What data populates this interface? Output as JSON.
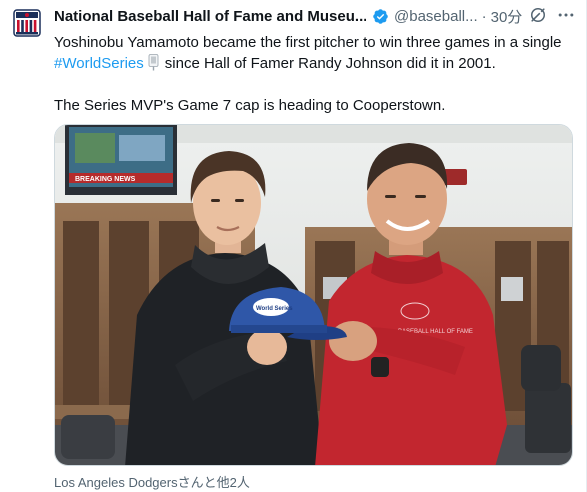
{
  "account": {
    "display_name": "National Baseball Hall of Fame and Museu...",
    "handle": "@baseball...",
    "separator": "·",
    "time": "30分",
    "avatar_icon": "hall-of-fame-logo-icon",
    "verified_icon": "verified-badge-icon",
    "verified_color": "#1d9bf0"
  },
  "post": {
    "line1": "Yoshinobu Yamamoto became the first pitcher to win three games in a single",
    "hashtag": "#WorldSeries",
    "line2_rest": "since Hall of Famer Randy Johnson did it in 2001.",
    "line3": "The Series MVP's Game 7 cap is heading to Cooperstown.",
    "hashtag_emoji_icon": "world-series-trophy-flag-icon",
    "link_color": "#1d9bf0"
  },
  "media": {
    "photo": "two-men-holding-baseball-cap-in-clubhouse",
    "tv_text": "BREAKING NEWS",
    "cap_text": "World Series",
    "shirt_text": "BASEBALL HALL OF FAME"
  },
  "footer": {
    "tagged": "Los Angeles Dodgersさんと他2人"
  },
  "icons": {
    "grok": "grok-icon",
    "more": "more-options-icon"
  }
}
